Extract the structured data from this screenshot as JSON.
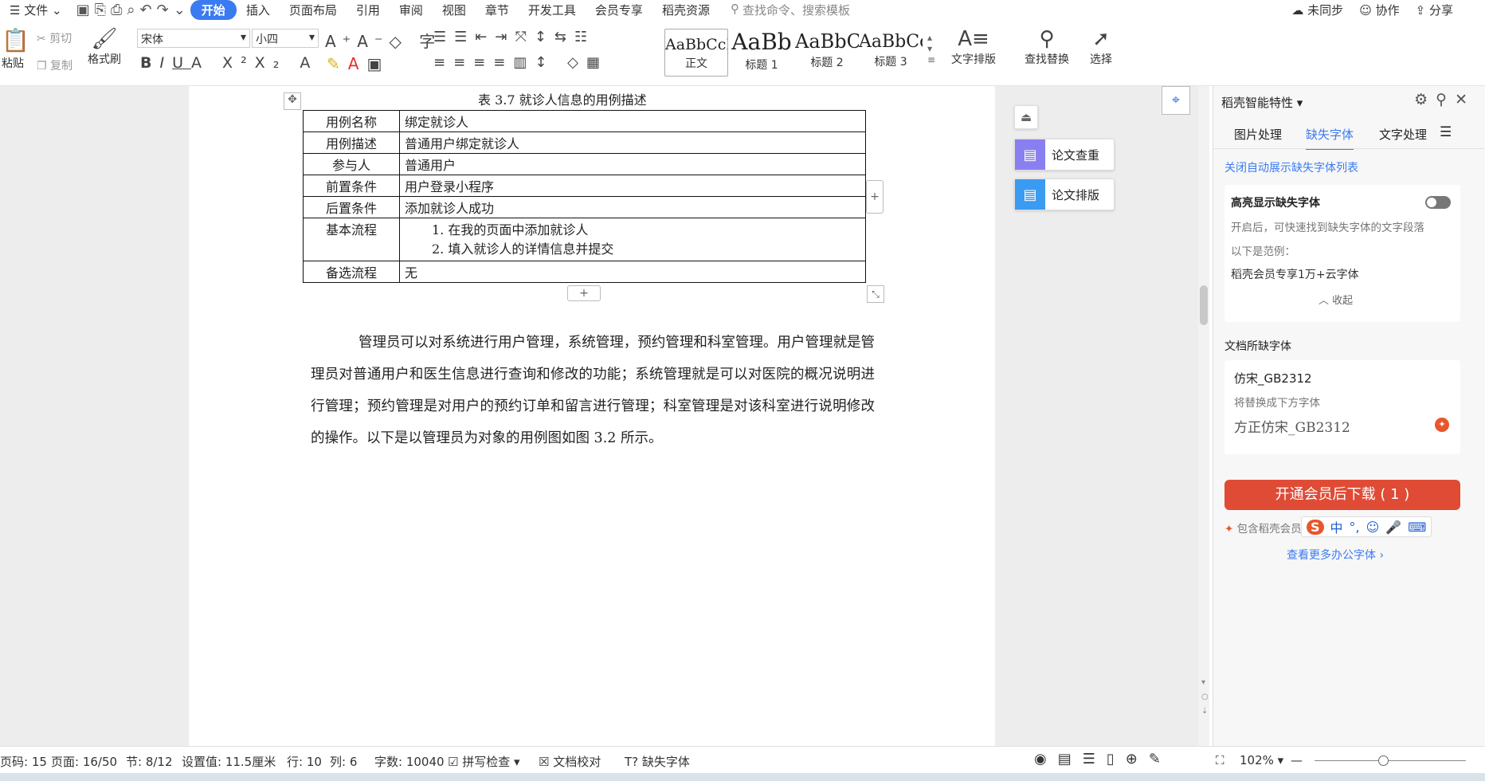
{
  "menu": {
    "file": "文件",
    "tabs": [
      "开始",
      "插入",
      "页面布局",
      "引用",
      "审阅",
      "视图",
      "章节",
      "开发工具",
      "会员专享",
      "稻壳资源"
    ],
    "search": "查找命令、搜索模板",
    "sync": "未同步",
    "collab": "协作",
    "share": "分享"
  },
  "ribbon": {
    "paste": "粘贴",
    "cut": "剪切",
    "copy": "复制",
    "format_painter": "格式刷",
    "font": "宋体",
    "size": "小四",
    "styles": [
      {
        "sample": "AaBbCcD",
        "label": "正文"
      },
      {
        "sample": "AaBb",
        "label": "标题 1"
      },
      {
        "sample": "AaBbC",
        "label": "标题 2"
      },
      {
        "sample": "AaBbCc",
        "label": "标题 3"
      }
    ],
    "text_layout": "文字排版",
    "find_replace": "查找替换",
    "select": "选择"
  },
  "doc": {
    "caption": "表 3.7  就诊人信息的用例描述",
    "rows": [
      {
        "k": "用例名称",
        "v": "绑定就诊人"
      },
      {
        "k": "用例描述",
        "v": "普通用户绑定就诊人"
      },
      {
        "k": "参与人",
        "v": "普通用户"
      },
      {
        "k": "前置条件",
        "v": "用户登录小程序"
      },
      {
        "k": "后置条件",
        "v": "添加就诊人成功"
      }
    ],
    "flow_key": "基本流程",
    "flow": [
      "1.   在我的页面中添加就诊人",
      "2.   填入就诊人的详情信息并提交"
    ],
    "alt_key": "备选流程",
    "alt_val": "无",
    "paragraph": "管理员可以对系统进行用户管理，系统管理，预约管理和科室管理。用户管理就是管理员对普通用户和医生信息进行查询和修改的功能；系统管理就是可以对医院的概况说明进行管理；预约管理是对用户的预约订单和留言进行管理；科室管理是对该科室进行说明修改的操作。以下是以管理员为对象的用例图如图 3.2 所示。"
  },
  "float": {
    "check": "论文查重",
    "layout": "论文排版"
  },
  "sidebar": {
    "title": "稻壳智能特性",
    "tabs": [
      "图片处理",
      "缺失字体",
      "文字处理"
    ],
    "close_auto": "关闭自动展示缺失字体列表",
    "highlight_title": "高亮显示缺失字体",
    "highlight_desc": "开启后，可快速找到缺失字体的文字段落",
    "example_label": "以下是范例：",
    "example": "稻壳会员专享1万+云字体",
    "collapse": "收起",
    "missing_label": "文档所缺字体",
    "missing_font": "仿宋_GB2312",
    "replace_label": "将替换成下方字体",
    "replace_font": "方正仿宋_GB2312",
    "download_btn": "开通会员后下载 ( 1 )",
    "include": "包含稻壳会员",
    "more_link": "查看更多办公字体 ›",
    "ime": "中"
  },
  "status": {
    "page_code": "页码: 15",
    "page": "页面: 16/50",
    "section": "节: 8/12",
    "setting": "设置值: 11.5厘米",
    "row": "行: 10",
    "col": "列: 6",
    "words": "字数: 10040",
    "spell": "拼写检查",
    "proof": "文档校对",
    "missing_font": "缺失字体",
    "zoom": "102%"
  }
}
